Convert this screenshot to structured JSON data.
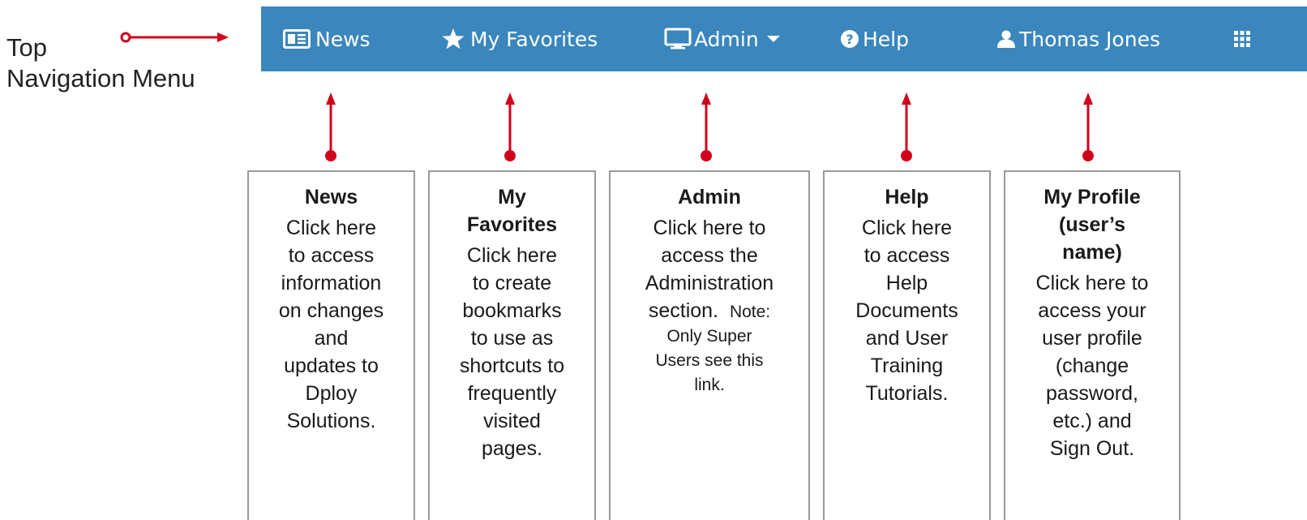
{
  "side_label": {
    "line1": "Top",
    "line2": "Navigation Menu"
  },
  "navbar": {
    "background": "#3a86bd",
    "items": [
      {
        "label": "News",
        "icon": "newspaper-icon"
      },
      {
        "label": "My Favorites",
        "icon": "star-icon"
      },
      {
        "label": "Admin",
        "icon": "monitor-icon",
        "caret_icon": "caret-down-icon"
      },
      {
        "label": "Help",
        "icon": "question-circle-icon"
      },
      {
        "label": "Thomas Jones",
        "icon": "user-icon"
      },
      {
        "label": "",
        "icon": "grid-menu-icon"
      }
    ]
  },
  "callout_color": "#d0021b",
  "boxes": [
    {
      "title": "News",
      "lines": [
        "Click here",
        "to access",
        "information",
        "on changes",
        "and",
        "updates to",
        "Dploy",
        "Solutions."
      ]
    },
    {
      "title_lines": [
        "My",
        "Favorites"
      ],
      "lines": [
        "Click here",
        "to create",
        "bookmarks",
        "to use as",
        "shortcuts to",
        "frequently",
        "visited",
        "pages."
      ]
    },
    {
      "title": "Admin",
      "lines": [
        "Click here to",
        "access the",
        "Administration"
      ],
      "line4_main": "section.",
      "line4_note": "Note:",
      "note_lines": [
        "Only Super",
        "Users see this",
        "link."
      ]
    },
    {
      "title": "Help",
      "lines": [
        "Click here",
        "to access",
        "Help",
        "Documents",
        "and User",
        "Training",
        "Tutorials."
      ]
    },
    {
      "title_lines": [
        "My Profile",
        "(user’s",
        "name)"
      ],
      "lines": [
        "Click here to",
        "access your",
        "user profile",
        "(change",
        "password,",
        "etc.) and",
        "Sign Out."
      ]
    }
  ]
}
